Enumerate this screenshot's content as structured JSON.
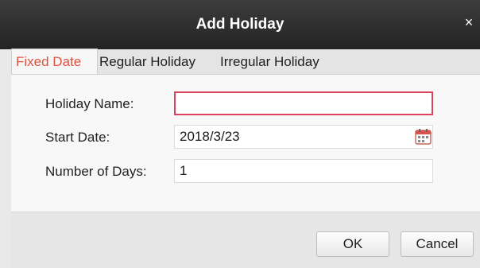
{
  "dialog": {
    "title": "Add Holiday",
    "close_glyph": "×"
  },
  "tabs": [
    {
      "label": "Fixed Date",
      "active": true
    },
    {
      "label": "Regular Holiday",
      "active": false
    },
    {
      "label": "Irregular Holiday",
      "active": false
    }
  ],
  "form": {
    "holiday_name_label": "Holiday Name:",
    "holiday_name_value": "",
    "start_date_label": "Start Date:",
    "start_date_value": "2018/3/23",
    "number_of_days_label": "Number of Days:",
    "number_of_days_value": "1",
    "calendar_icon": "calendar-icon"
  },
  "buttons": {
    "ok_label": "OK",
    "cancel_label": "Cancel"
  },
  "colors": {
    "active_tab_text": "#e0523f",
    "focused_border": "#d9445a",
    "titlebar": "#2e2e2e"
  }
}
